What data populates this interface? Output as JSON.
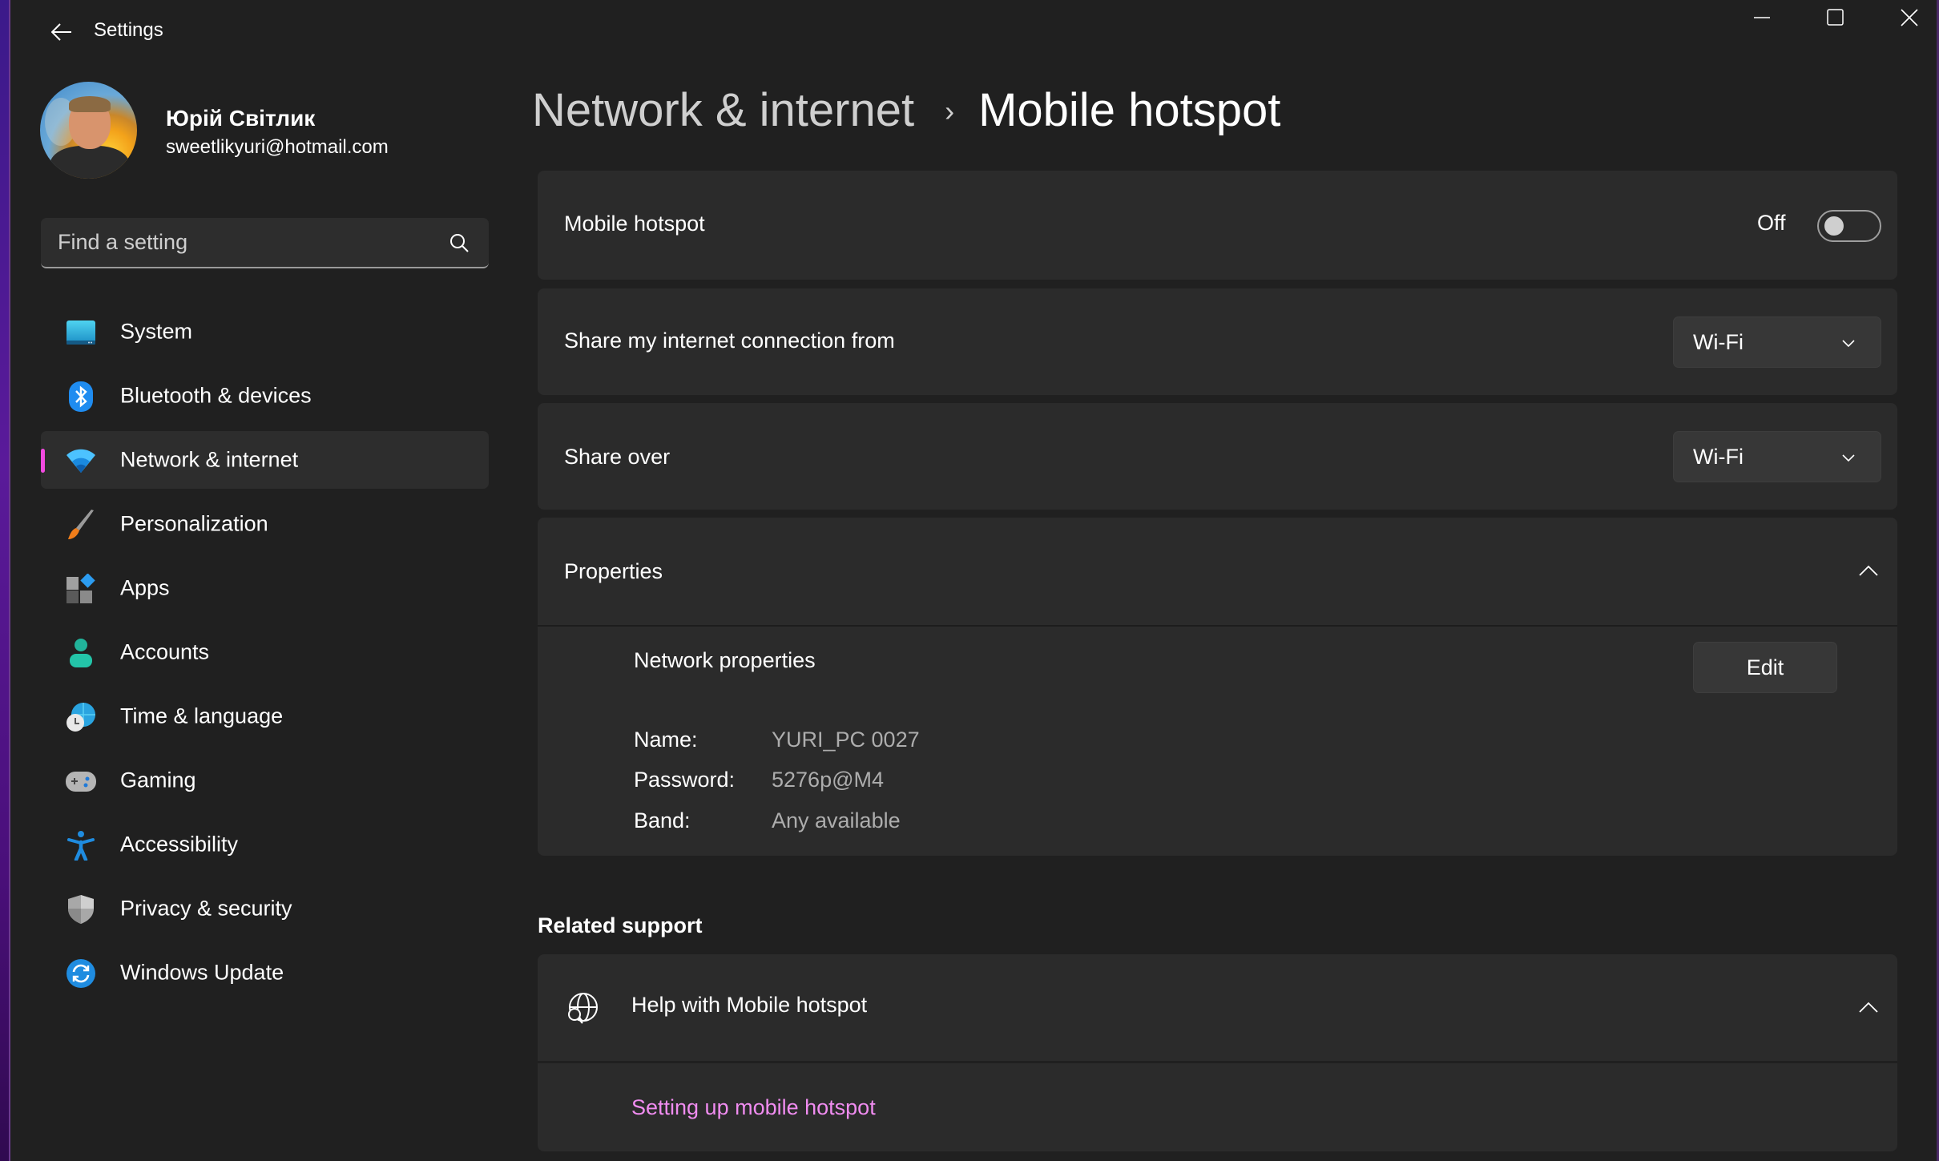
{
  "window": {
    "app_title": "Settings",
    "caption": {
      "minimize": "minimize",
      "maximize": "maximize",
      "close": "close"
    }
  },
  "profile": {
    "name": "Юрій Світлик",
    "email": "sweetlikyuri@hotmail.com"
  },
  "search": {
    "placeholder": "Find a setting",
    "value": ""
  },
  "sidebar": {
    "items": [
      {
        "label": "System",
        "icon": "system-icon",
        "active": false
      },
      {
        "label": "Bluetooth & devices",
        "icon": "bluetooth-icon",
        "active": false
      },
      {
        "label": "Network & internet",
        "icon": "wifi-icon",
        "active": true
      },
      {
        "label": "Personalization",
        "icon": "paintbrush-icon",
        "active": false
      },
      {
        "label": "Apps",
        "icon": "apps-icon",
        "active": false
      },
      {
        "label": "Accounts",
        "icon": "accounts-icon",
        "active": false
      },
      {
        "label": "Time & language",
        "icon": "time-language-icon",
        "active": false
      },
      {
        "label": "Gaming",
        "icon": "gamepad-icon",
        "active": false
      },
      {
        "label": "Accessibility",
        "icon": "accessibility-icon",
        "active": false
      },
      {
        "label": "Privacy & security",
        "icon": "shield-icon",
        "active": false
      },
      {
        "label": "Windows Update",
        "icon": "windows-update-icon",
        "active": false
      }
    ],
    "accent_color": "#f24ae0"
  },
  "breadcrumb": {
    "parent": "Network & internet",
    "separator": "›",
    "current": "Mobile hotspot"
  },
  "settings": {
    "hotspot": {
      "label": "Mobile hotspot",
      "state_text": "Off",
      "enabled": false
    },
    "share_from": {
      "label": "Share my internet connection from",
      "value": "Wi-Fi"
    },
    "share_over": {
      "label": "Share over",
      "value": "Wi-Fi"
    },
    "properties": {
      "label": "Properties",
      "expanded": true,
      "section_title": "Network properties",
      "edit_label": "Edit",
      "rows": [
        {
          "key": "Name:",
          "value": "YURI_PC 0027"
        },
        {
          "key": "Password:",
          "value": "5276p@M4"
        },
        {
          "key": "Band:",
          "value": "Any available"
        }
      ]
    }
  },
  "related_support": {
    "title": "Related support",
    "help": {
      "label": "Help with Mobile hotspot",
      "expanded": true
    },
    "links": [
      {
        "label": "Setting up mobile hotspot",
        "color": "#f08cf0"
      }
    ]
  }
}
